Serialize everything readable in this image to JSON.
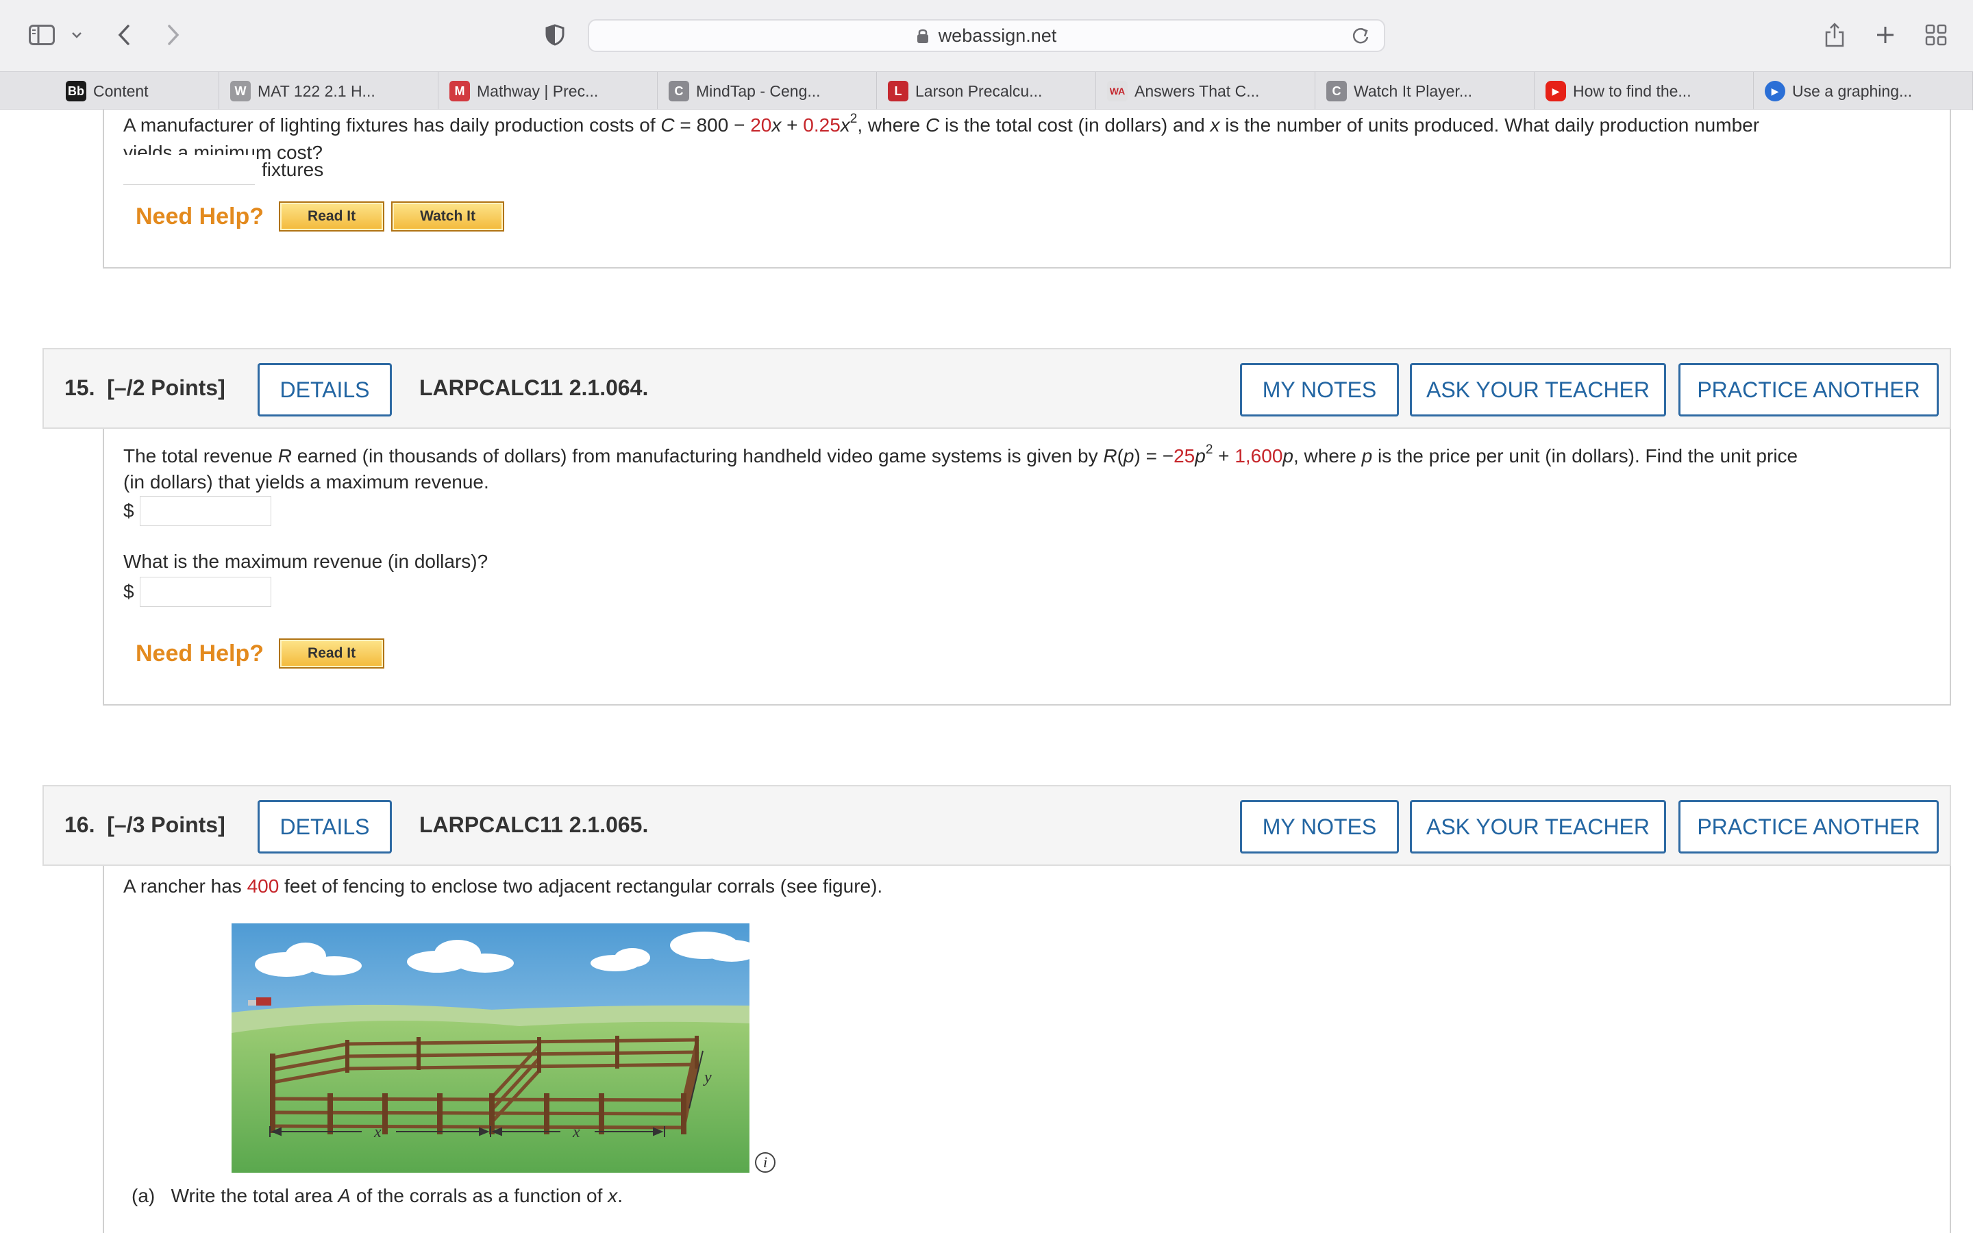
{
  "browser": {
    "url": "webassign.net",
    "tabs": [
      {
        "label": "Content",
        "favicon": "Bb",
        "color": "#1a1a1a"
      },
      {
        "label": "MAT 122 2.1 H...",
        "favicon": "W",
        "color": "#9a9a9e"
      },
      {
        "label": "Mathway | Prec...",
        "favicon": "M",
        "color": "#d2393f"
      },
      {
        "label": "MindTap - Ceng...",
        "favicon": "C",
        "color": "#8a8a90"
      },
      {
        "label": "Larson Precalcu...",
        "favicon": "L",
        "color": "#c5282f"
      },
      {
        "label": "Answers That C...",
        "favicon": "WA",
        "color": "#e0e0e2"
      },
      {
        "label": "Watch It Player...",
        "favicon": "C",
        "color": "#8a8a90"
      },
      {
        "label": "How to find the...",
        "favicon": "▶",
        "color": "#e62117"
      },
      {
        "label": "Use a graphing...",
        "favicon": "▶",
        "color": "#2b6fd6"
      }
    ]
  },
  "q14": {
    "line1_a": "A manufacturer of lighting fixtures has daily production costs of ",
    "c_var": "C",
    "eq_a": " = 800 − ",
    "coef1": "20",
    "x_var": "x",
    "plus": " + ",
    "coef2": "0.25",
    "x2": "x",
    "exp": "2",
    "line1_b": ", where ",
    "c_var2": "C",
    "line1_c": " is the total cost (in dollars) and ",
    "x_var2": "x",
    "line1_d": " is the number of units produced. What daily production number",
    "line2": "yields a minimum cost?",
    "unit": "fixtures",
    "need_help": "Need Help?",
    "read_it": "Read It",
    "watch_it": "Watch It"
  },
  "q15": {
    "number": "15.",
    "points": "[–/2 Points]",
    "details": "DETAILS",
    "code": "LARPCALC11 2.1.064.",
    "my_notes": "MY NOTES",
    "ask_teacher": "ASK YOUR TEACHER",
    "practice": "PRACTICE ANOTHER",
    "text_a": "The total revenue ",
    "r_var": "R",
    "text_b": " earned (in thousands of dollars) from manufacturing handheld video game systems is given by ",
    "r_fn": "R",
    "p_arg": "p",
    "text_c": ") = −",
    "coef1": "25",
    "p1": "p",
    "exp": "2",
    "plus": " + ",
    "coef2": "1,600",
    "p2": "p",
    "text_d": ", where ",
    "p3": "p",
    "text_e": " is the price per unit (in dollars). Find the unit price",
    "line2": "(in dollars) that yields a maximum revenue.",
    "dollar1": "$",
    "q2": "What is the maximum revenue (in dollars)?",
    "dollar2": "$",
    "need_help": "Need Help?",
    "read_it": "Read It"
  },
  "q16": {
    "number": "16.",
    "points": "[–/3 Points]",
    "details": "DETAILS",
    "code": "LARPCALC11 2.1.065.",
    "my_notes": "MY NOTES",
    "ask_teacher": "ASK YOUR TEACHER",
    "practice": "PRACTICE ANOTHER",
    "text_a": "A rancher has ",
    "feet": "400",
    "text_b": " feet of fencing to enclose two adjacent rectangular corrals (see figure).",
    "fig_label_x1": "x",
    "fig_label_x2": "x",
    "fig_label_y": "y",
    "info": "i",
    "part_a_label": "(a)",
    "part_a_text_1": "Write the total area ",
    "area_var": "A",
    "part_a_text_2": " of the corrals as a function of ",
    "part_a_x": "x",
    "part_a_text_3": "."
  }
}
